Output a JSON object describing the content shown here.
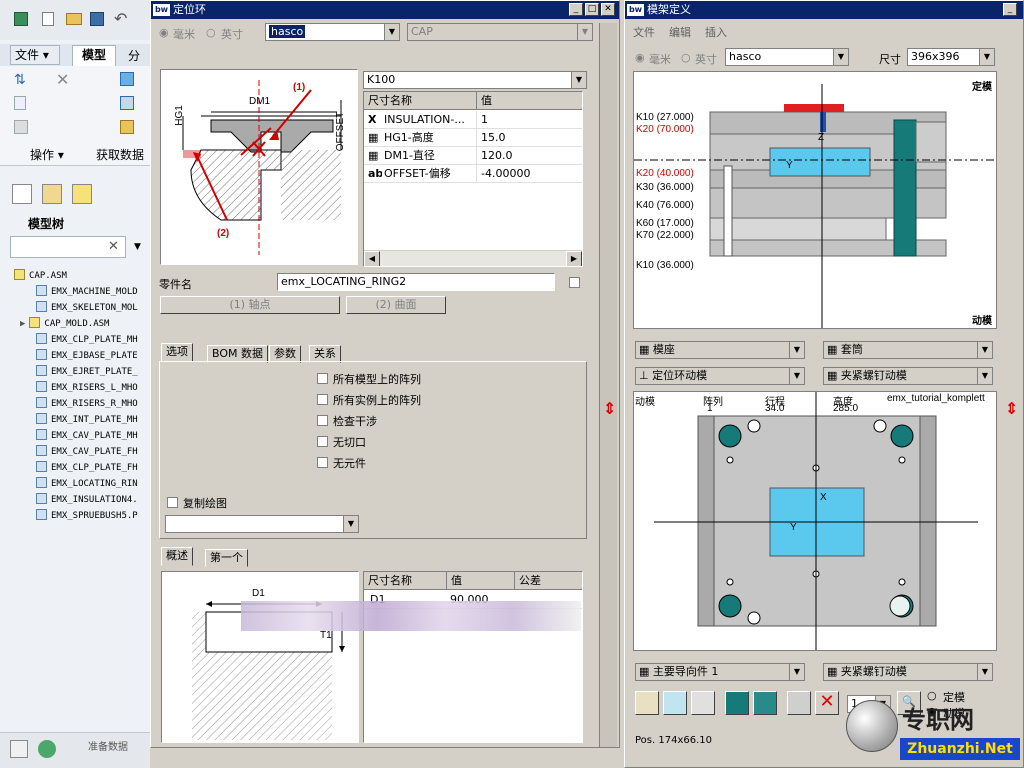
{
  "left_panel": {
    "menu_file": "文件",
    "menu_model": "模型",
    "menu_analysis": "分",
    "group_operations": "操作",
    "group_get_data": "获取数据",
    "tree_title": "模型树",
    "status_text": "准备数据",
    "tree_root": "CAP.ASM",
    "tree_items": [
      "EMX_MACHINE_MOLD",
      "EMX_SKELETON_MOL",
      "CAP_MOLD.ASM",
      "EMX_CLP_PLATE_MH",
      "EMX_EJBASE_PLATE",
      "EMX_EJRET_PLATE_",
      "EMX_RISERS_L_MHO",
      "EMX_RISERS_R_MHO",
      "EMX_INT_PLATE_MH",
      "EMX_CAV_PLATE_MH",
      "EMX_CAV_PLATE_FH",
      "EMX_CLP_PLATE_FH",
      "EMX_LOCATING_RIN",
      "EMX_INSULATION4.",
      "EMX_SPRUEBUSH5.P"
    ]
  },
  "locating_ring_dialog": {
    "title": "定位环",
    "unit_mm": "毫米",
    "unit_inch": "英寸",
    "supplier": "hasco",
    "cap_combo": "CAP",
    "type_combo": "K100",
    "table_headers": [
      "尺寸名称",
      "值"
    ],
    "table_rows": [
      {
        "icon": "X",
        "name": "INSULATION-...",
        "value": "1"
      },
      {
        "icon": "▦",
        "name": "HG1-高度",
        "value": "15.0"
      },
      {
        "icon": "▦",
        "name": "DM1-直径",
        "value": "120.0"
      },
      {
        "icon": "ab",
        "name": "OFFSET-偏移",
        "value": "-4.00000"
      }
    ],
    "diagram_labels": {
      "hg1": "HG1",
      "dm1": "DM1",
      "offset": "OFFSET",
      "p1": "(1)",
      "p2": "(2)"
    },
    "part_name_label": "零件名",
    "part_name_value": "emx_LOCATING_RING2",
    "btn_axis": "(1) 轴点",
    "btn_surface": "(2) 曲面",
    "tabs": [
      "选项",
      "BOM 数据",
      "参数",
      "关系"
    ],
    "options": [
      "所有模型上的阵列",
      "所有实例上的阵列",
      "检查干涉",
      "无切口",
      "无元件"
    ],
    "copy_drawing": "复制绘图",
    "desc_tabs": [
      "概述",
      "第一个"
    ],
    "lower_headers": [
      "尺寸名称",
      "值",
      "公差"
    ],
    "lower_rows": [
      {
        "name": "D1",
        "value": "90.000",
        "tol": ""
      }
    ],
    "lower_diagram": {
      "d1": "D1",
      "t1": "T1"
    }
  },
  "mold_dialog": {
    "title": "模架定义",
    "menu": [
      "文件",
      "编辑",
      "插入"
    ],
    "unit_mm": "毫米",
    "unit_inch": "英寸",
    "supplier": "hasco",
    "size_label": "尺寸",
    "size_value": "396x396",
    "fixed_label": "定模",
    "moving_label": "动模",
    "plate_labels": [
      {
        "text": "K10 (27.000)",
        "red": false
      },
      {
        "text": "K20 (70.000)",
        "red": true
      },
      {
        "text": "K20 (40.000)",
        "red": true
      },
      {
        "text": "K30 (36.000)",
        "red": false
      },
      {
        "text": "K40 (76.000)",
        "red": false
      },
      {
        "text": "K60 (17.000)",
        "red": false
      },
      {
        "text": "K70 (22.000)",
        "red": false
      },
      {
        "text": "K10 (36.000)",
        "red": false
      }
    ],
    "combo_base": "模座",
    "combo_sleeve": "套筒",
    "combo_locating": "定位环动模",
    "combo_clamp": "夹紧螺钉动模",
    "info_moving": "动模",
    "info_pattern_label": "阵列",
    "info_pattern_value": "1",
    "info_stroke_label": "行程",
    "info_stroke_value": "34.0",
    "info_height_label": "高度",
    "info_height_value": "285.0",
    "info_name": "emx_tutorial_komplett",
    "combo_guide": "主要导向件 1",
    "combo_clamp2": "夹紧螺钉动模",
    "spin_value": "1",
    "radio_fixed": "定模",
    "radio_moving": "动模",
    "pos_text": "Pos. 174x66.10",
    "axis_z": "Z",
    "axis_y": "Y",
    "axis_x": "X"
  },
  "watermark": {
    "cn": "专职网",
    "url": "Zhuanzhi.Net"
  },
  "colors": {
    "title_blue": "#0a246a",
    "red_label": "#d00000",
    "plate_cyan": "#5bc8ee",
    "teal": "#167a78"
  }
}
